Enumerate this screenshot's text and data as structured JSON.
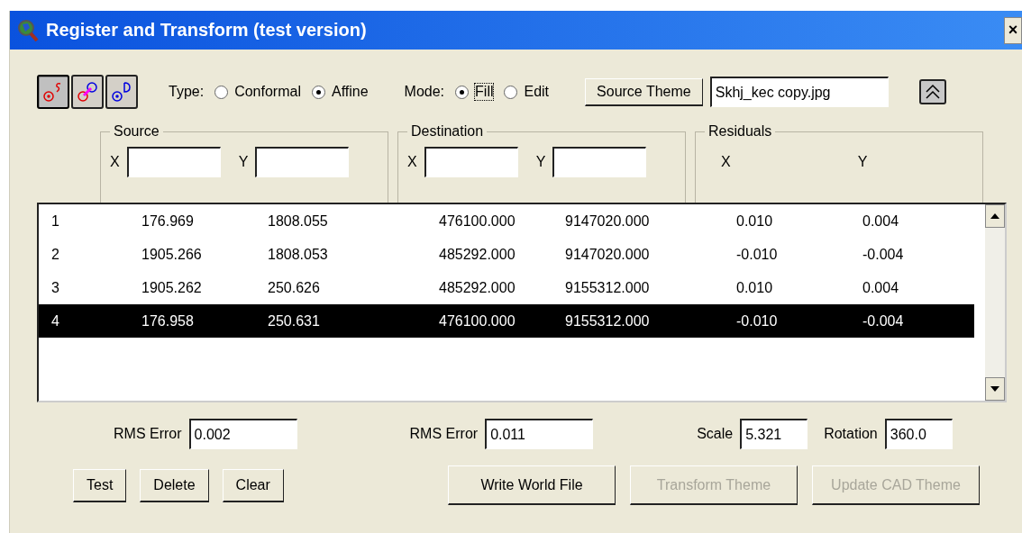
{
  "window": {
    "title": "Register and Transform (test version)",
    "close": "×"
  },
  "toolbar": {
    "tools": [
      {
        "kind": "source",
        "selected": true
      },
      {
        "kind": "link",
        "selected": false
      },
      {
        "kind": "destination",
        "selected": false
      }
    ],
    "type": {
      "label": "Type:",
      "options": [
        {
          "label": "Conformal",
          "selected": false
        },
        {
          "label": "Affine",
          "selected": true
        }
      ]
    },
    "mode": {
      "label": "Mode:",
      "options": [
        {
          "label": "Fill",
          "selected": true
        },
        {
          "label": "Edit",
          "selected": false
        }
      ]
    },
    "source_theme_button": "Source Theme",
    "source_theme_field": "Skhj_kec copy.jpg"
  },
  "groups": [
    {
      "title": "Source",
      "x_label": "X",
      "y_label": "Y",
      "kind": "input"
    },
    {
      "title": "Destination",
      "x_label": "X",
      "y_label": "Y",
      "kind": "input"
    },
    {
      "title": "Residuals",
      "x_label": "X",
      "y_label": "Y",
      "kind": "label"
    }
  ],
  "table": {
    "rows": [
      {
        "cells": [
          "1",
          "176.969",
          "1808.055",
          "476100.000",
          "9147020.000",
          "0.010",
          "0.004"
        ],
        "selected": false
      },
      {
        "cells": [
          "2",
          "1905.266",
          "1808.053",
          "485292.000",
          "9147020.000",
          "-0.010",
          "-0.004"
        ],
        "selected": false
      },
      {
        "cells": [
          "3",
          "1905.262",
          "250.626",
          "485292.000",
          "9155312.000",
          "0.010",
          "0.004"
        ],
        "selected": false
      },
      {
        "cells": [
          "4",
          "176.958",
          "250.631",
          "476100.000",
          "9155312.000",
          "-0.010",
          "-0.004"
        ],
        "selected": true
      }
    ]
  },
  "rms_source": {
    "label": "RMS Error",
    "value": "0.002"
  },
  "rms_destination": {
    "label": "RMS Error",
    "value": "0.011"
  },
  "scale": {
    "label": "Scale",
    "value": "5.321"
  },
  "rotation": {
    "label": "Rotation",
    "value": "360.0"
  },
  "left_buttons": [
    {
      "label": "Test",
      "disabled": false
    },
    {
      "label": "Delete",
      "disabled": false
    },
    {
      "label": "Clear",
      "disabled": false
    }
  ],
  "right_buttons": [
    {
      "label": "Write World File",
      "disabled": false
    },
    {
      "label": "Transform Theme",
      "disabled": true
    },
    {
      "label": "Update CAD Theme",
      "disabled": true
    }
  ]
}
